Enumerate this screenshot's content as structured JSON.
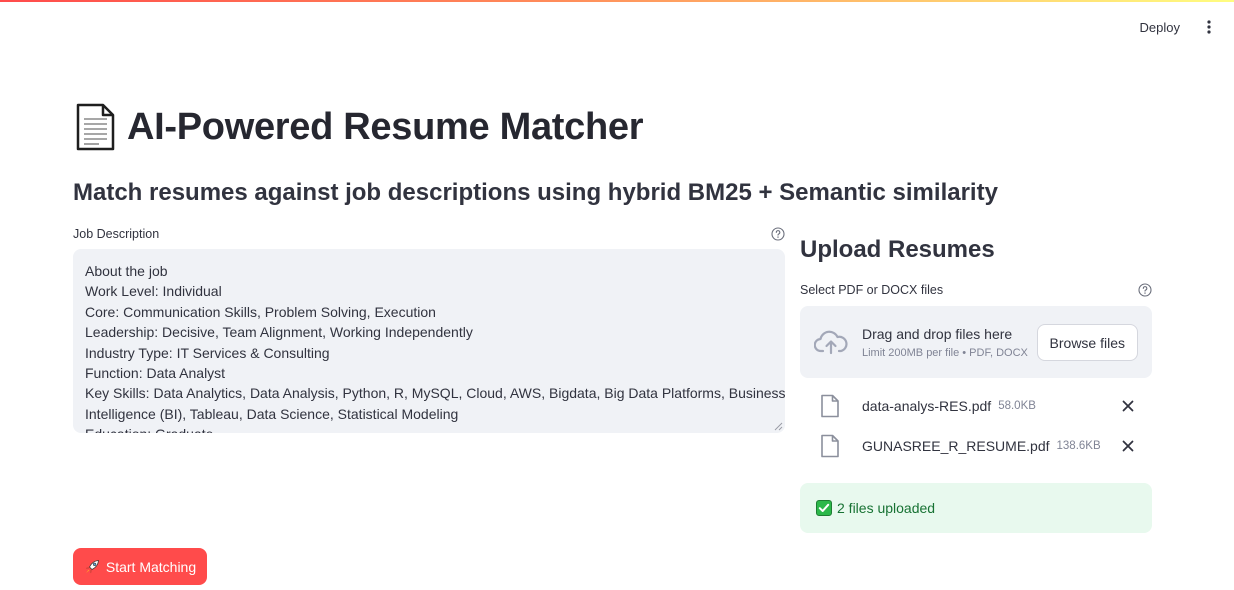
{
  "header": {
    "deploy_label": "Deploy",
    "menu_icon": "vertical-ellipsis-icon"
  },
  "page": {
    "title": "AI-Powered Resume Matcher",
    "title_icon": "page-document-emoji",
    "subtitle": "Match resumes against job descriptions using hybrid BM25 + Semantic similarity"
  },
  "job_description": {
    "label": "Job Description",
    "lines": [
      "About the job",
      "Work Level: Individual",
      "Core: Communication Skills, Problem Solving, Execution",
      "Leadership: Decisive, Team Alignment, Working Independently",
      "Industry Type: IT Services & Consulting",
      "Function: Data Analyst",
      "Key Skills: Data Analytics, Data Analysis, Python, R, MySQL, Cloud, AWS, Bigdata, Big Data Platforms, Business",
      "Intelligence (BI), Tableau, Data Science, Statistical Modeling",
      "Education: Graduate"
    ]
  },
  "upload": {
    "heading": "Upload Resumes",
    "label": "Select PDF or DOCX files",
    "dropzone_text": "Drag and drop files here",
    "dropzone_limit": "Limit 200MB per file • PDF, DOCX",
    "browse_label": "Browse files",
    "files": [
      {
        "name": "data-analys-RES.pdf",
        "size": "58.0KB"
      },
      {
        "name": "GUNASREE_R_RESUME.pdf",
        "size": "138.6KB"
      }
    ],
    "status": "2 files uploaded"
  },
  "actions": {
    "start_label": "Start Matching"
  },
  "colors": {
    "primary": "#ff4b4b",
    "success_bg": "#e8f9ee",
    "success_text": "#177233",
    "input_bg": "#f0f2f6"
  }
}
